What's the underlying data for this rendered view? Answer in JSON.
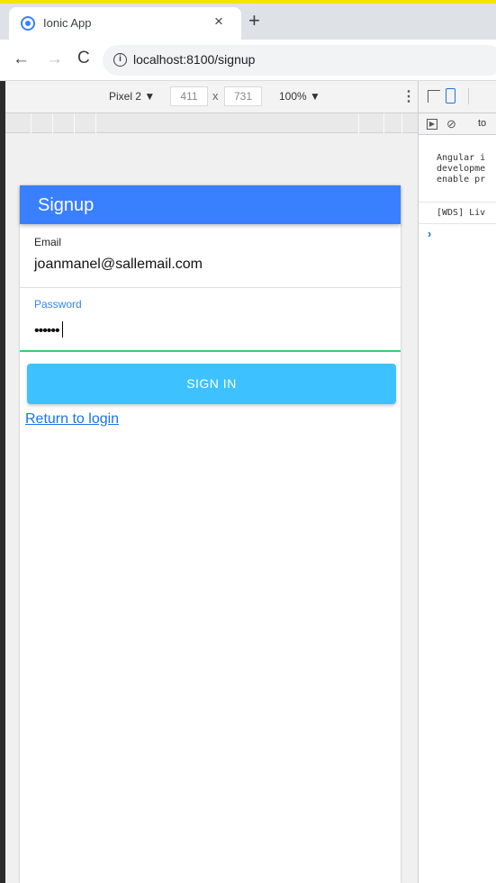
{
  "browser": {
    "tab_title": "Ionic App",
    "tab_close": "×",
    "new_tab": "+",
    "nav_back": "←",
    "nav_forward": "→",
    "nav_reload": "C",
    "url": "localhost:8100/signup"
  },
  "device_toolbar": {
    "device": "Pixel 2 ▼",
    "width": "411",
    "separator": "x",
    "height": "731",
    "zoom": "100% ▼"
  },
  "app": {
    "header_title": "Signup",
    "email_label": "Email",
    "email_value": "joanmanel@sallemail.com",
    "password_label": "Password",
    "password_value": "••••••",
    "signin_button": "SIGN IN",
    "return_link": "Return to login",
    "header_color": "#3880ff",
    "button_color": "#3dc2ff",
    "focus_color": "#2dd36f"
  },
  "devtools": {
    "context": "to",
    "log_1": "Angular i\ndevelopme\nenable pr",
    "log_2": "[WDS] Liv",
    "prompt": "›"
  }
}
